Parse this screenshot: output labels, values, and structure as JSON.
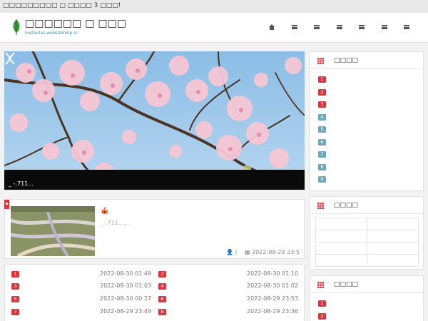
{
  "topbar": {
    "text": "□□□□□□□□□ □ □□□□ 3 □□□!"
  },
  "header": {
    "title": "□□□□□□ □ □□□",
    "domain": "kostenlos.websitehelp.in",
    "nav": [
      {
        "icon": "home-icon"
      },
      {
        "icon": "menu-glyph-icon"
      },
      {
        "icon": "menu-glyph-icon"
      },
      {
        "icon": "menu-glyph-icon"
      },
      {
        "icon": "menu-glyph-icon"
      },
      {
        "icon": "menu-glyph-icon"
      },
      {
        "icon": "menu-glyph-icon"
      }
    ]
  },
  "slider": {
    "caption": "_ -,711..."
  },
  "article": {
    "icon_text": "🎪",
    "excerpt": "_-,711..  ...",
    "meta_user": "👤 |",
    "meta_date": "2022-08-29 23:5"
  },
  "list": [
    {
      "num": "1",
      "date": "2022-08-30 01:49"
    },
    {
      "num": "2",
      "date": "2022-08-30 01:10"
    },
    {
      "num": "3",
      "date": "2022-08-30 01:03"
    },
    {
      "num": "4",
      "date": "2022-08-30 01:02"
    },
    {
      "num": "5",
      "date": "2022-08-30 00:27"
    },
    {
      "num": "6",
      "date": "2022-08-29 23:53"
    },
    {
      "num": "7",
      "date": "2022-08-29 23:49"
    },
    {
      "num": "8",
      "date": "2022-08-29 23:36"
    }
  ],
  "sidebar": {
    "box1": {
      "title": "□□□□",
      "items": [
        "1",
        "2",
        "3",
        "4",
        "5",
        "6",
        "7",
        "8",
        "9"
      ]
    },
    "box2": {
      "title": "□□□□"
    },
    "box3": {
      "title": "□□□□",
      "items": [
        "1",
        "2"
      ]
    }
  },
  "colors": {
    "accent": "#d9363e",
    "grey_badge": "#6fa8b8",
    "domain": "#3d8fb0"
  }
}
